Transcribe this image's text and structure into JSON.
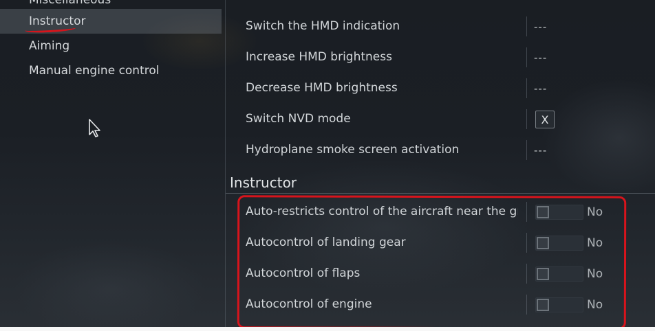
{
  "sidebar": {
    "items": [
      {
        "label": "Miscellaneous",
        "selected": false
      },
      {
        "label": "Instructor",
        "selected": true
      },
      {
        "label": "Aiming",
        "selected": false
      },
      {
        "label": "Manual engine control",
        "selected": false
      }
    ]
  },
  "controls": {
    "rows": [
      {
        "label": "Switch the HMD indication",
        "value": "---"
      },
      {
        "label": "Increase HMD brightness",
        "value": "---"
      },
      {
        "label": "Decrease HMD brightness",
        "value": "---"
      },
      {
        "label": "Switch NVD mode",
        "value": "X"
      },
      {
        "label": "Hydroplane smoke screen activation",
        "value": "---"
      }
    ]
  },
  "instructor": {
    "title": "Instructor",
    "rows": [
      {
        "label": "Auto-restricts control of the aircraft near the ground",
        "state": "No",
        "on": false
      },
      {
        "label": "Autocontrol of landing gear",
        "state": "No",
        "on": false
      },
      {
        "label": "Autocontrol of flaps",
        "state": "No",
        "on": false
      },
      {
        "label": "Autocontrol of engine",
        "state": "No",
        "on": false
      }
    ]
  },
  "colors": {
    "annotation_red": "#d8141c",
    "selected_bg": "#545b63"
  }
}
